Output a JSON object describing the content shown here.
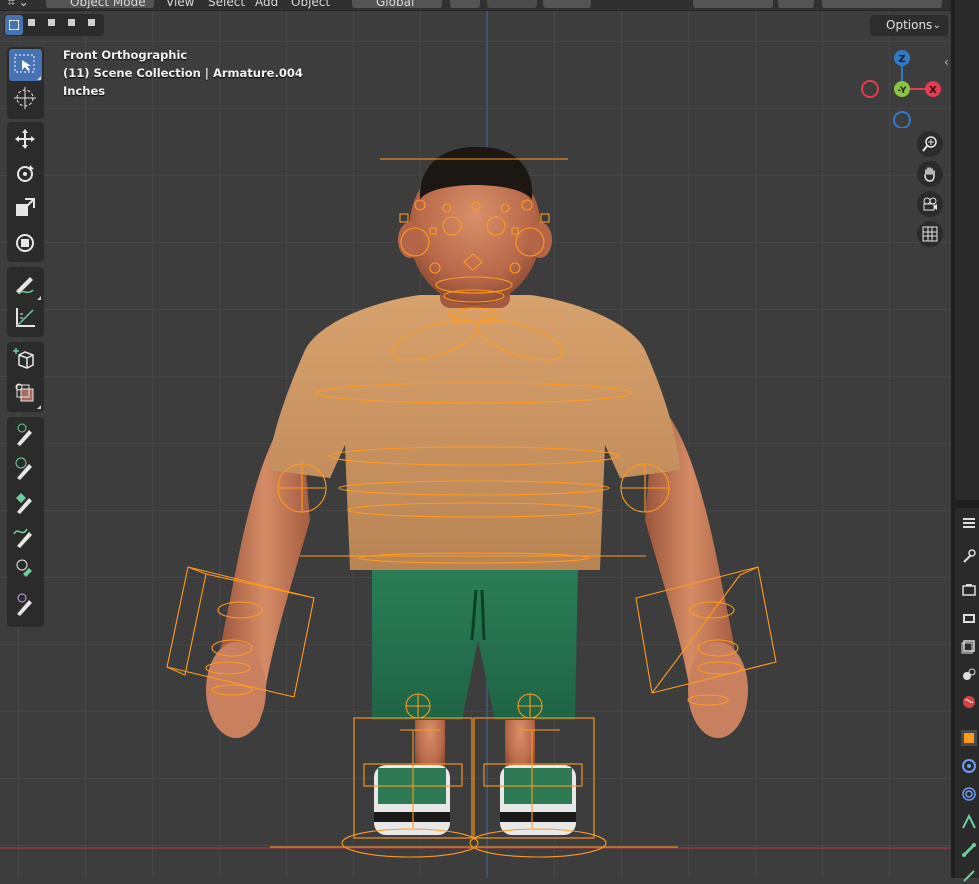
{
  "header": {
    "mode_label": "Object Mode",
    "menus": [
      "View",
      "Select",
      "Add",
      "Object"
    ],
    "orientation_label": "Global"
  },
  "toolbar_row": {
    "options_label": "Options"
  },
  "viewport_info": {
    "view_name": "Front Orthographic",
    "collection": "(11) Scene Collection | Armature.004",
    "units": "Inches"
  },
  "gizmo": {
    "z_label": "Z",
    "y_label": "-Y",
    "x_label": "X",
    "colors": {
      "x": "#e53d4f",
      "y": "#8bc53f",
      "z": "#2f7bc8"
    }
  },
  "tools": [
    "select-box",
    "cursor",
    "move",
    "rotate",
    "scale",
    "transform",
    "annotate",
    "measure",
    "add-cube",
    "extrude-region",
    "spin",
    "spin-duplicates",
    "smooth",
    "randomize",
    "edge-slide",
    "shrink-fatten"
  ],
  "colors": {
    "accent": "#4772b3",
    "armature": "#ff9a1f",
    "viewport_bg": "#3d3d3d"
  }
}
